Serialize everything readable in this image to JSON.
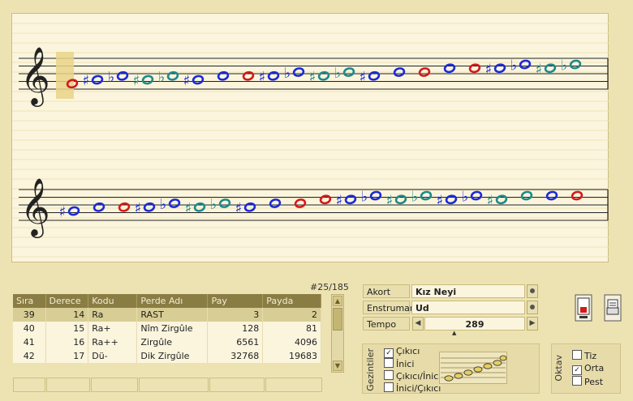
{
  "counter": "#25/185",
  "table": {
    "headers": [
      "Sıra",
      "Derece",
      "Kodu",
      "Perde Adı",
      "Pay",
      "Payda"
    ],
    "rows": [
      [
        "39",
        "14",
        "Ra",
        "RAST",
        "3",
        "2"
      ],
      [
        "40",
        "15",
        "Ra+",
        "Nîm Zirgûle",
        "128",
        "81"
      ],
      [
        "41",
        "16",
        "Ra++",
        "Zirgûle",
        "6561",
        "4096"
      ],
      [
        "42",
        "17",
        "Dü-",
        "Dik Zirgûle",
        "32768",
        "19683"
      ]
    ],
    "selected_row": 0
  },
  "controls": {
    "akort_label": "Akort",
    "akort_value": "Kız Neyi",
    "enstruman_label": "Enstruman",
    "enstruman_value": "Ud",
    "tempo_label": "Tempo",
    "tempo_value": "289"
  },
  "gezintiler": {
    "label": "Gezintiler",
    "options": [
      {
        "label": "Çıkıcı",
        "checked": true
      },
      {
        "label": "İnici",
        "checked": false
      },
      {
        "label": "Çıkıcı/İnici",
        "checked": false
      },
      {
        "label": "İnici/Çıkıcı",
        "checked": false
      }
    ]
  },
  "oktav": {
    "label": "Oktav",
    "options": [
      {
        "label": "Tiz",
        "checked": false
      },
      {
        "label": "Orta",
        "checked": true
      },
      {
        "label": "Pest",
        "checked": false
      }
    ]
  },
  "score": {
    "clef": "treble-clef-icon",
    "staff1_notes": [
      {
        "acc": "",
        "color": "red",
        "step": 1
      },
      {
        "acc": "sharp",
        "color": "blue",
        "step": 2
      },
      {
        "acc": "flat",
        "color": "blue",
        "step": 3
      },
      {
        "acc": "sharp",
        "color": "teal",
        "step": 2
      },
      {
        "acc": "flat",
        "color": "teal",
        "step": 3
      },
      {
        "acc": "sharp",
        "color": "blue",
        "step": 2
      },
      {
        "acc": "",
        "color": "blue",
        "step": 3
      },
      {
        "acc": "",
        "color": "red",
        "step": 3
      },
      {
        "acc": "sharp",
        "color": "blue",
        "step": 3
      },
      {
        "acc": "flat",
        "color": "blue",
        "step": 4
      },
      {
        "acc": "sharp",
        "color": "teal",
        "step": 3
      },
      {
        "acc": "flat",
        "color": "teal",
        "step": 4
      },
      {
        "acc": "sharp",
        "color": "blue",
        "step": 3
      },
      {
        "acc": "",
        "color": "blue",
        "step": 4
      },
      {
        "acc": "",
        "color": "red",
        "step": 4
      },
      {
        "acc": "",
        "color": "blue",
        "step": 5
      },
      {
        "acc": "",
        "color": "red",
        "step": 5
      },
      {
        "acc": "sharp",
        "color": "blue",
        "step": 5
      },
      {
        "acc": "flat",
        "color": "blue",
        "step": 6
      },
      {
        "acc": "sharp",
        "color": "teal",
        "step": 5
      },
      {
        "acc": "flat",
        "color": "teal",
        "step": 6
      }
    ],
    "staff2_notes": [
      {
        "acc": "sharp",
        "color": "blue",
        "step": 2
      },
      {
        "acc": "",
        "color": "blue",
        "step": 3
      },
      {
        "acc": "",
        "color": "red",
        "step": 3
      },
      {
        "acc": "sharp",
        "color": "blue",
        "step": 3
      },
      {
        "acc": "flat",
        "color": "blue",
        "step": 4
      },
      {
        "acc": "sharp",
        "color": "teal",
        "step": 3
      },
      {
        "acc": "flat",
        "color": "teal",
        "step": 4
      },
      {
        "acc": "sharp",
        "color": "blue",
        "step": 3
      },
      {
        "acc": "",
        "color": "blue",
        "step": 4
      },
      {
        "acc": "",
        "color": "red",
        "step": 4
      },
      {
        "acc": "",
        "color": "red",
        "step": 5
      },
      {
        "acc": "sharp",
        "color": "blue",
        "step": 5
      },
      {
        "acc": "flat",
        "color": "blue",
        "step": 6
      },
      {
        "acc": "sharp",
        "color": "teal",
        "step": 5
      },
      {
        "acc": "flat",
        "color": "teal",
        "step": 6
      },
      {
        "acc": "sharp",
        "color": "blue",
        "step": 5
      },
      {
        "acc": "flat",
        "color": "blue",
        "step": 6
      },
      {
        "acc": "sharp",
        "color": "teal",
        "step": 5
      },
      {
        "acc": "",
        "color": "teal",
        "step": 6
      },
      {
        "acc": "",
        "color": "blue",
        "step": 6
      },
      {
        "acc": "",
        "color": "red",
        "step": 6
      }
    ]
  },
  "colors": {
    "red": "#d21a1a",
    "blue": "#1a2ad8",
    "teal": "#1e8a8a",
    "highlight": "#e8d488"
  }
}
